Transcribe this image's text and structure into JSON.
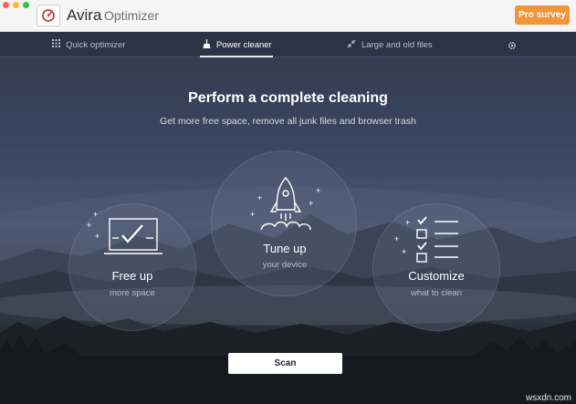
{
  "window": {
    "brand": "Avira",
    "product": "Optimizer",
    "pro_button": "Pro survey",
    "logo_icon": "avira-gauge-logo"
  },
  "tabs": [
    {
      "label": "Quick optimizer",
      "icon": "grid-icon",
      "active": false
    },
    {
      "label": "Power cleaner",
      "icon": "broom-icon",
      "active": true
    },
    {
      "label": "Large and old files",
      "icon": "collapse-arrows-icon",
      "active": false
    }
  ],
  "settings_icon": "gear-icon",
  "main": {
    "heading": "Perform a complete cleaning",
    "subheading": "Get more free space, remove all junk files and browser trash"
  },
  "features": [
    {
      "title": "Free up",
      "subtitle": "more space",
      "icon": "laptop-check-icon"
    },
    {
      "title": "Tune up",
      "subtitle": "your device",
      "icon": "rocket-icon"
    },
    {
      "title": "Customize",
      "subtitle": "what to clean",
      "icon": "checklist-icon"
    }
  ],
  "scan_button": "Scan",
  "watermark": "wsxdn.com",
  "colors": {
    "accent": "#f0953a",
    "titlebar": "#f5f5f6",
    "main_bg": "#3a4660"
  }
}
